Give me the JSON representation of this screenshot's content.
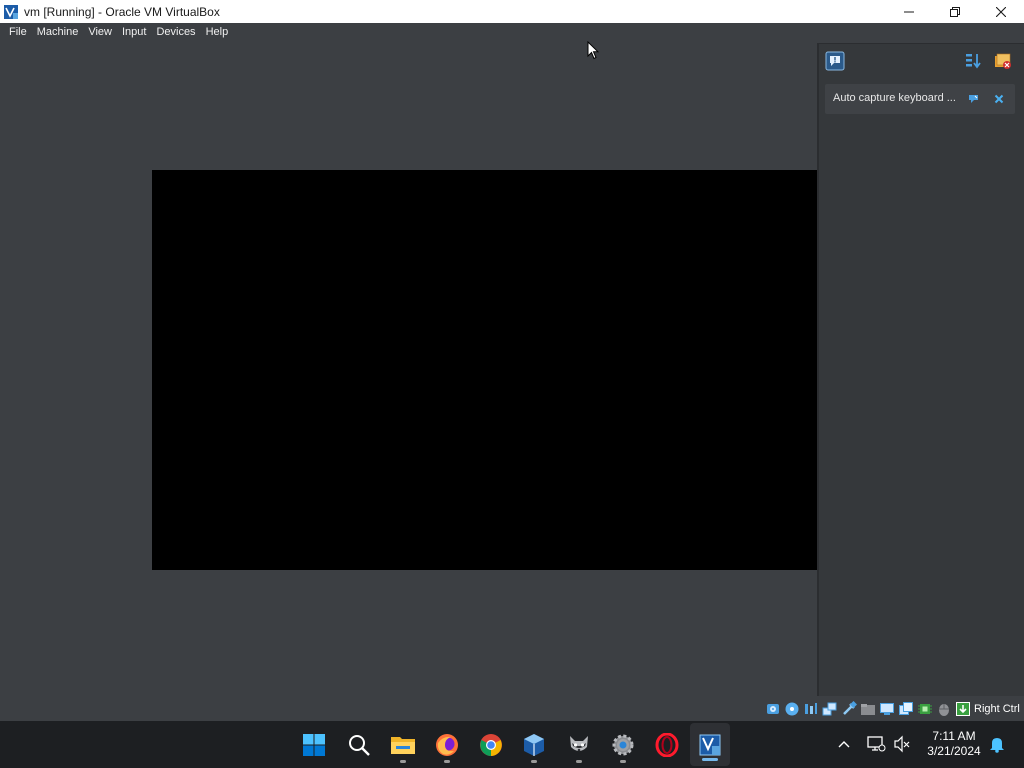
{
  "window": {
    "title": "vm [Running] - Oracle VM VirtualBox"
  },
  "menu": {
    "items": [
      "File",
      "Machine",
      "View",
      "Input",
      "Devices",
      "Help"
    ]
  },
  "notification_center": {
    "items": [
      {
        "text": "Auto capture keyboard ..."
      }
    ]
  },
  "statusbar": {
    "icons": [
      "hard-disk-icon",
      "optical-drive-icon",
      "audio-icon",
      "network-icon",
      "usb-icon",
      "shared-folders-icon",
      "display-icon",
      "recording-icon",
      "cpu-icon",
      "mouse-integration-icon",
      "keyboard-capture-icon"
    ],
    "host_key": "Right Ctrl"
  },
  "taskbar": {
    "apps": [
      "start",
      "search",
      "file-explorer",
      "firefox",
      "chrome",
      "virtualbox",
      "raccoon-app",
      "settings",
      "opera",
      "virtualbox-vm"
    ],
    "time": "7:11 AM",
    "date": "3/21/2024"
  },
  "colors": {
    "background": "#3c3f43",
    "titlebar": "#ffffff",
    "taskbar": "#1d1f22",
    "accent": "#76b9ed"
  }
}
